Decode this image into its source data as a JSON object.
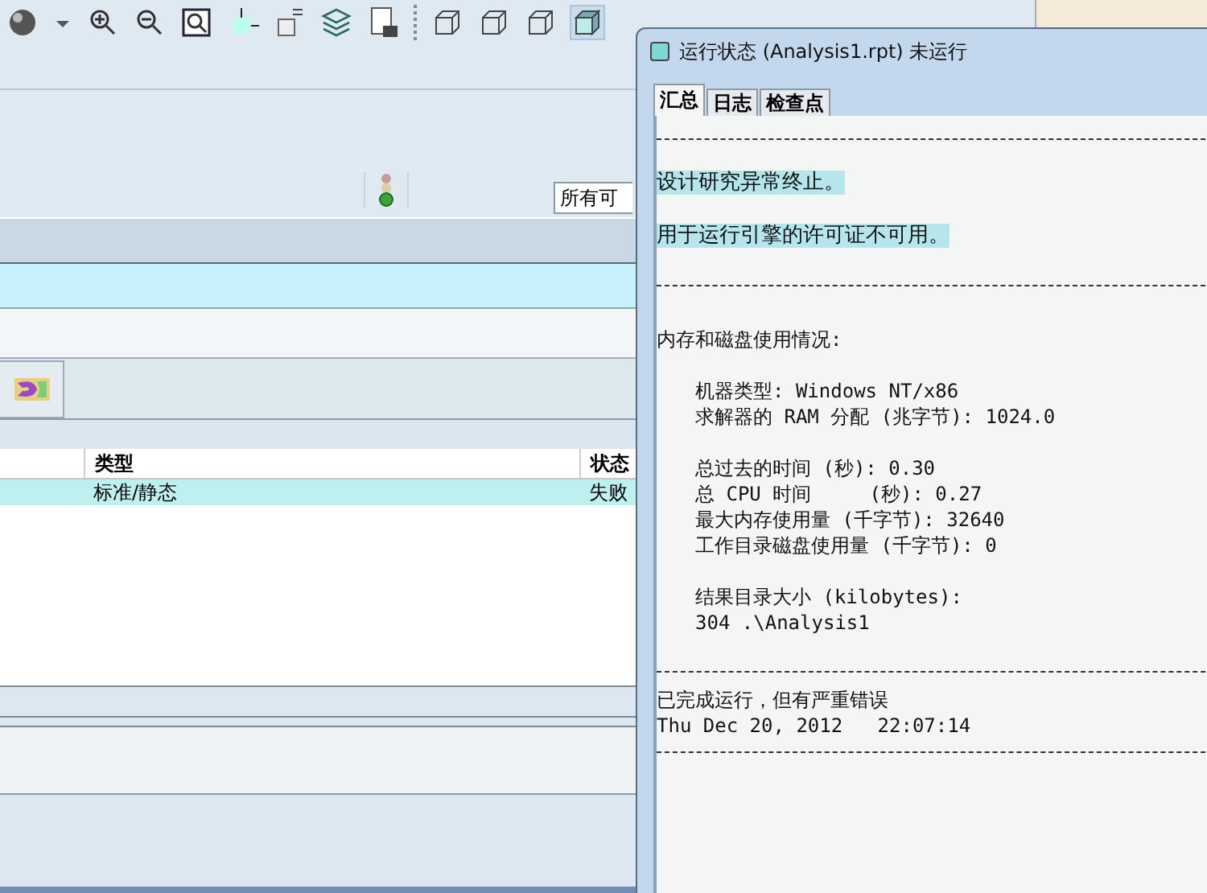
{
  "filter_dropdown": {
    "value": "所有可"
  },
  "table": {
    "columns": [
      {
        "label": "类型"
      },
      {
        "label": "状态"
      }
    ],
    "rows": [
      {
        "cells": [
          "标准/静态",
          "失败"
        ],
        "selected": true
      }
    ]
  },
  "dialog": {
    "title": "运行状态 (Analysis1.rpt) 未运行",
    "tabs": [
      {
        "label": "汇总",
        "selected": true
      },
      {
        "label": "日志",
        "selected": false
      },
      {
        "label": "检查点",
        "selected": false
      }
    ],
    "report": [
      {
        "kind": "rule"
      },
      {
        "kind": "message",
        "lines": [
          "设计研究异常终止。",
          "用于运行引擎的许可证不可用。"
        ]
      },
      {
        "kind": "rule"
      },
      {
        "kind": "plain",
        "lines": [
          "内存和磁盘使用情况:"
        ]
      },
      {
        "kind": "detail",
        "lines": [
          "机器类型: Windows NT/x86",
          "求解器的 RAM 分配 (兆字节): 1024.0"
        ]
      },
      {
        "kind": "detail",
        "lines": [
          "总过去的时间 (秒): 0.30",
          "总 CPU 时间     (秒): 0.27",
          "最大内存使用量 (千字节): 32640",
          "工作目录磁盘使用量 (千字节): 0"
        ]
      },
      {
        "kind": "detail",
        "lines": [
          "结果目录大小 (kilobytes):",
          "304 .\\Analysis1"
        ]
      },
      {
        "kind": "rule"
      },
      {
        "kind": "tail",
        "lines": [
          "已完成运行，但有严重错误",
          "Thu Dec 20, 2012   22:07:14"
        ]
      },
      {
        "kind": "rule"
      }
    ]
  }
}
